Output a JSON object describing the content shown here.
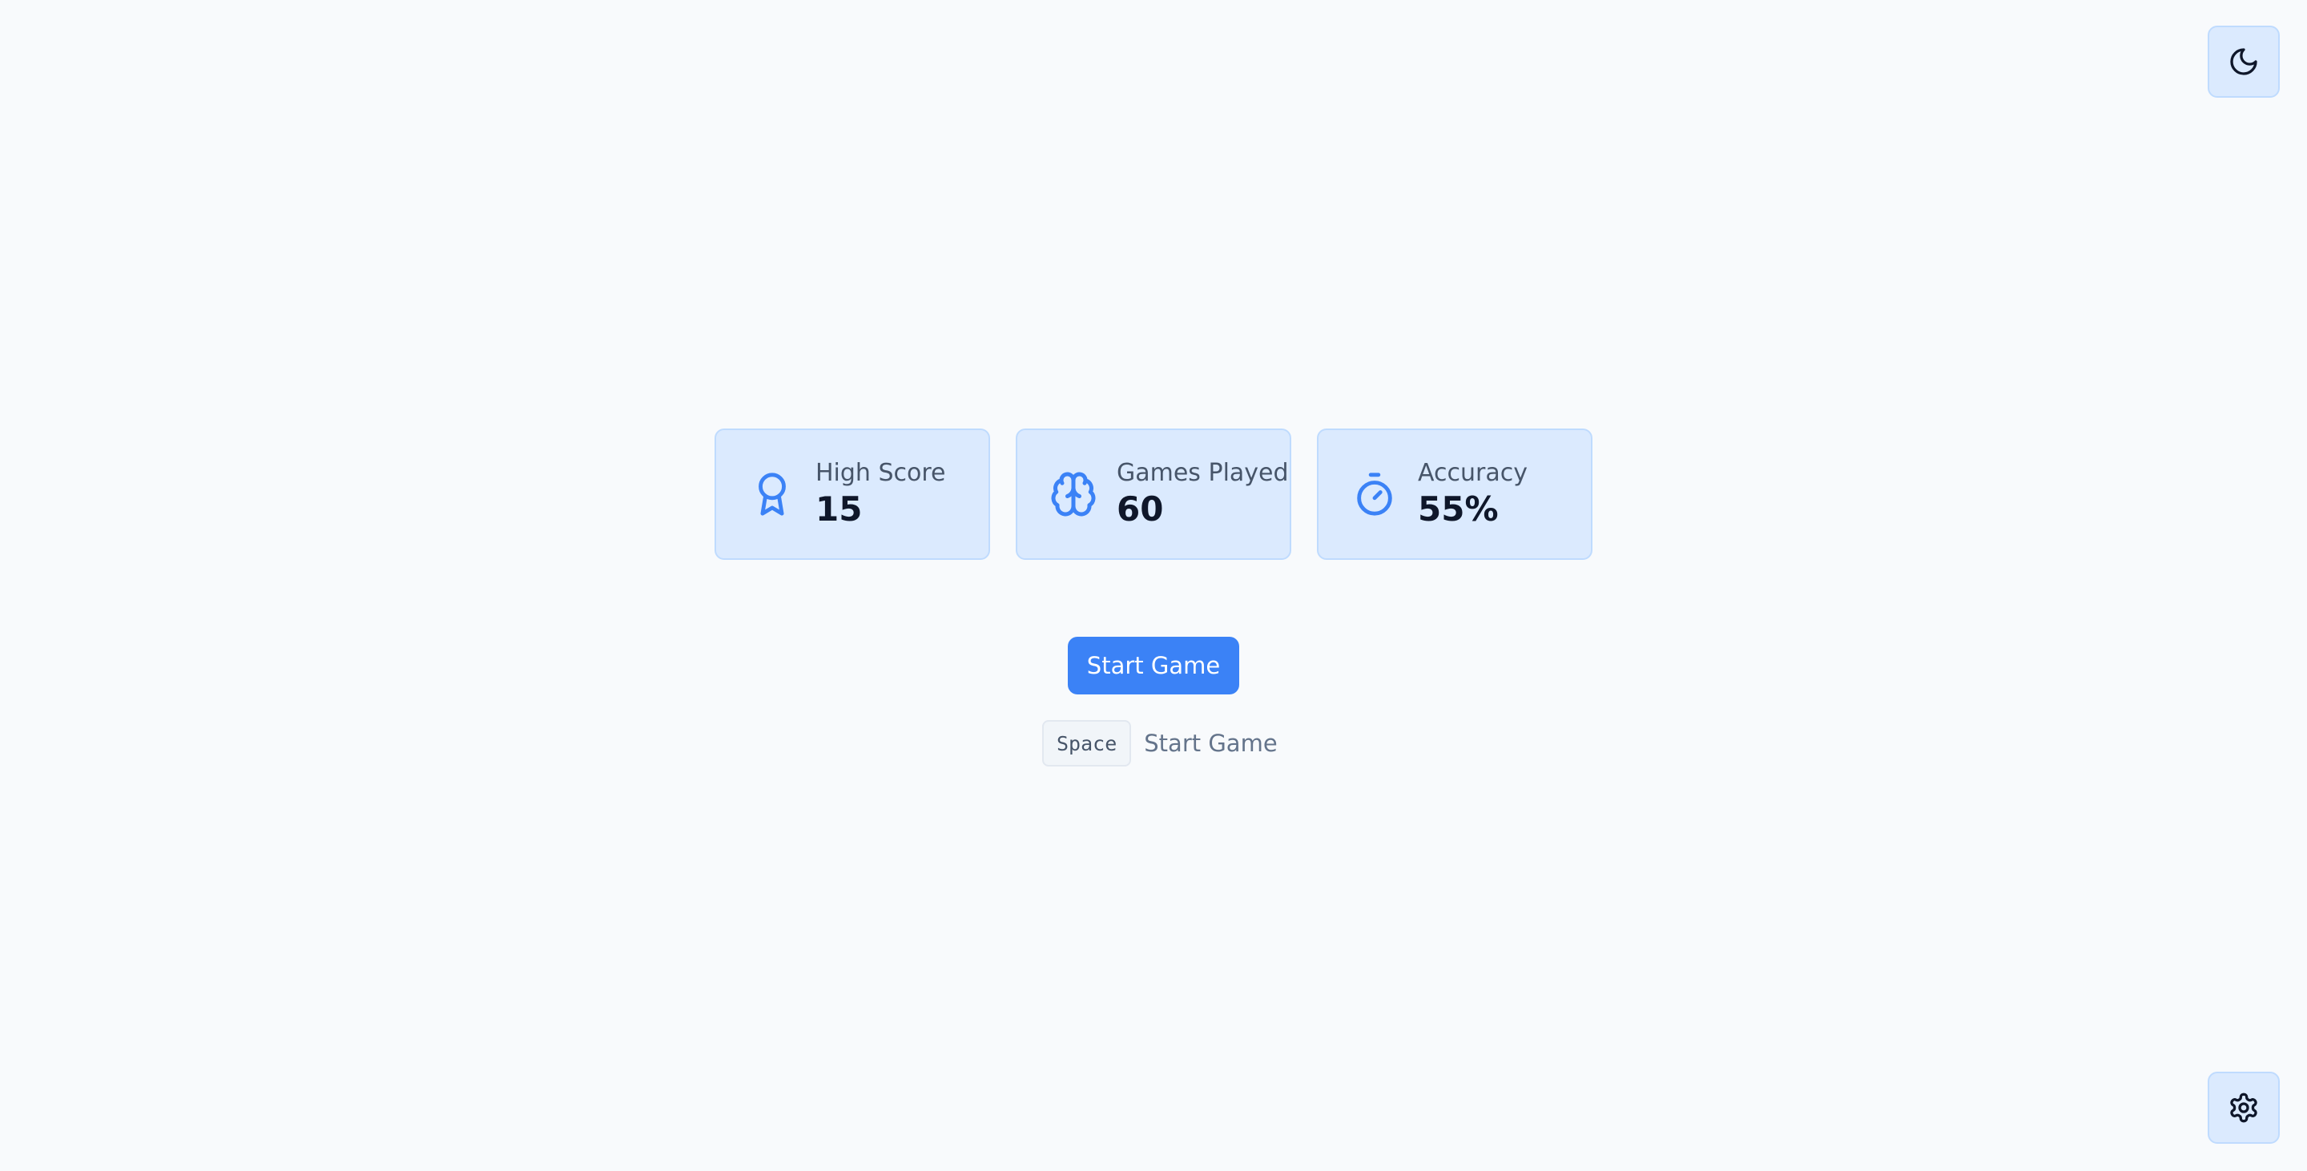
{
  "theme_toggle": {
    "icon": "moon-icon"
  },
  "settings": {
    "icon": "gear-icon"
  },
  "stats": [
    {
      "icon": "award-icon",
      "label": "High Score",
      "value": "15"
    },
    {
      "icon": "brain-icon",
      "label": "Games Played",
      "value": "60"
    },
    {
      "icon": "timer-icon",
      "label": "Accuracy",
      "value": "55%"
    }
  ],
  "start_button": {
    "label": "Start Game"
  },
  "shortcut": {
    "key": "Space",
    "label": "Start Game"
  },
  "colors": {
    "background": "#f8fafc",
    "card": "#dbeafe",
    "accent": "#3b82f6",
    "text": "#0f172a"
  }
}
